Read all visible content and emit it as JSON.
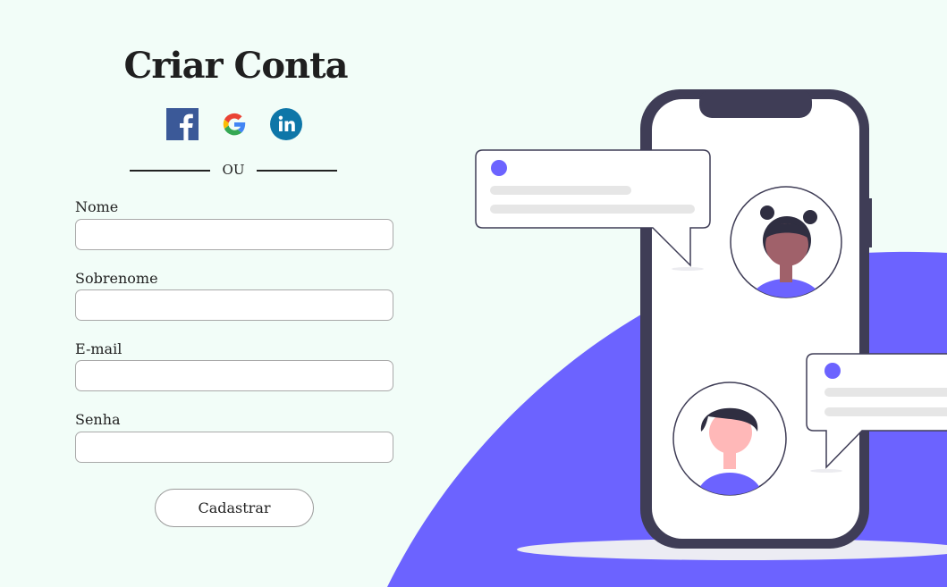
{
  "form": {
    "title": "Criar Conta",
    "divider_text": "OU",
    "social": [
      {
        "name": "facebook-icon",
        "color": "#3b5998"
      },
      {
        "name": "google-icon",
        "color": "#4285f4"
      },
      {
        "name": "linkedin-icon",
        "color": "#0e76a8"
      }
    ],
    "fields": {
      "first_name": {
        "label": "Nome",
        "value": "",
        "placeholder": ""
      },
      "last_name": {
        "label": "Sobrenome",
        "value": "",
        "placeholder": ""
      },
      "email": {
        "label": "E-mail",
        "value": "",
        "placeholder": ""
      },
      "password": {
        "label": "Senha",
        "value": "",
        "placeholder": ""
      }
    },
    "submit_label": "Cadastrar"
  },
  "theme": {
    "background": "#f2fdf8",
    "accent": "#6c63ff",
    "phone_frame": "#3f3d56",
    "skin_dark": "#a0616a",
    "skin_light": "#ffb8b8"
  }
}
